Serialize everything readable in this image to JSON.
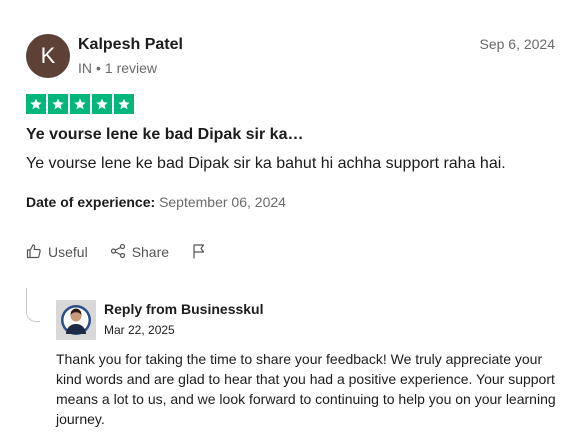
{
  "reviewer": {
    "initial": "K",
    "name": "Kalpesh Patel",
    "country": "IN",
    "separator": "•",
    "review_count": "1 review",
    "avatar_color": "#5e4136"
  },
  "review": {
    "posted_date": "Sep 6, 2024",
    "rating": 5,
    "rating_max": 5,
    "star_color": "#00b67a",
    "title": "Ye vourse lene ke bad Dipak sir ka…",
    "body": "Ye vourse lene ke bad Dipak sir ka bahut hi achha support raha hai.",
    "experience_label": "Date of experience:",
    "experience_date": "September 06, 2024"
  },
  "actions": {
    "useful_label": "Useful",
    "share_label": "Share"
  },
  "reply": {
    "from_label": "Reply from Businesskul",
    "date": "Mar 22, 2025",
    "text": "Thank you for taking the time to share your feedback! We truly appreciate your kind words and are glad to hear that you had a positive experience. Your support means a lot to us, and we look forward to continuing to help you on your learning journey."
  }
}
